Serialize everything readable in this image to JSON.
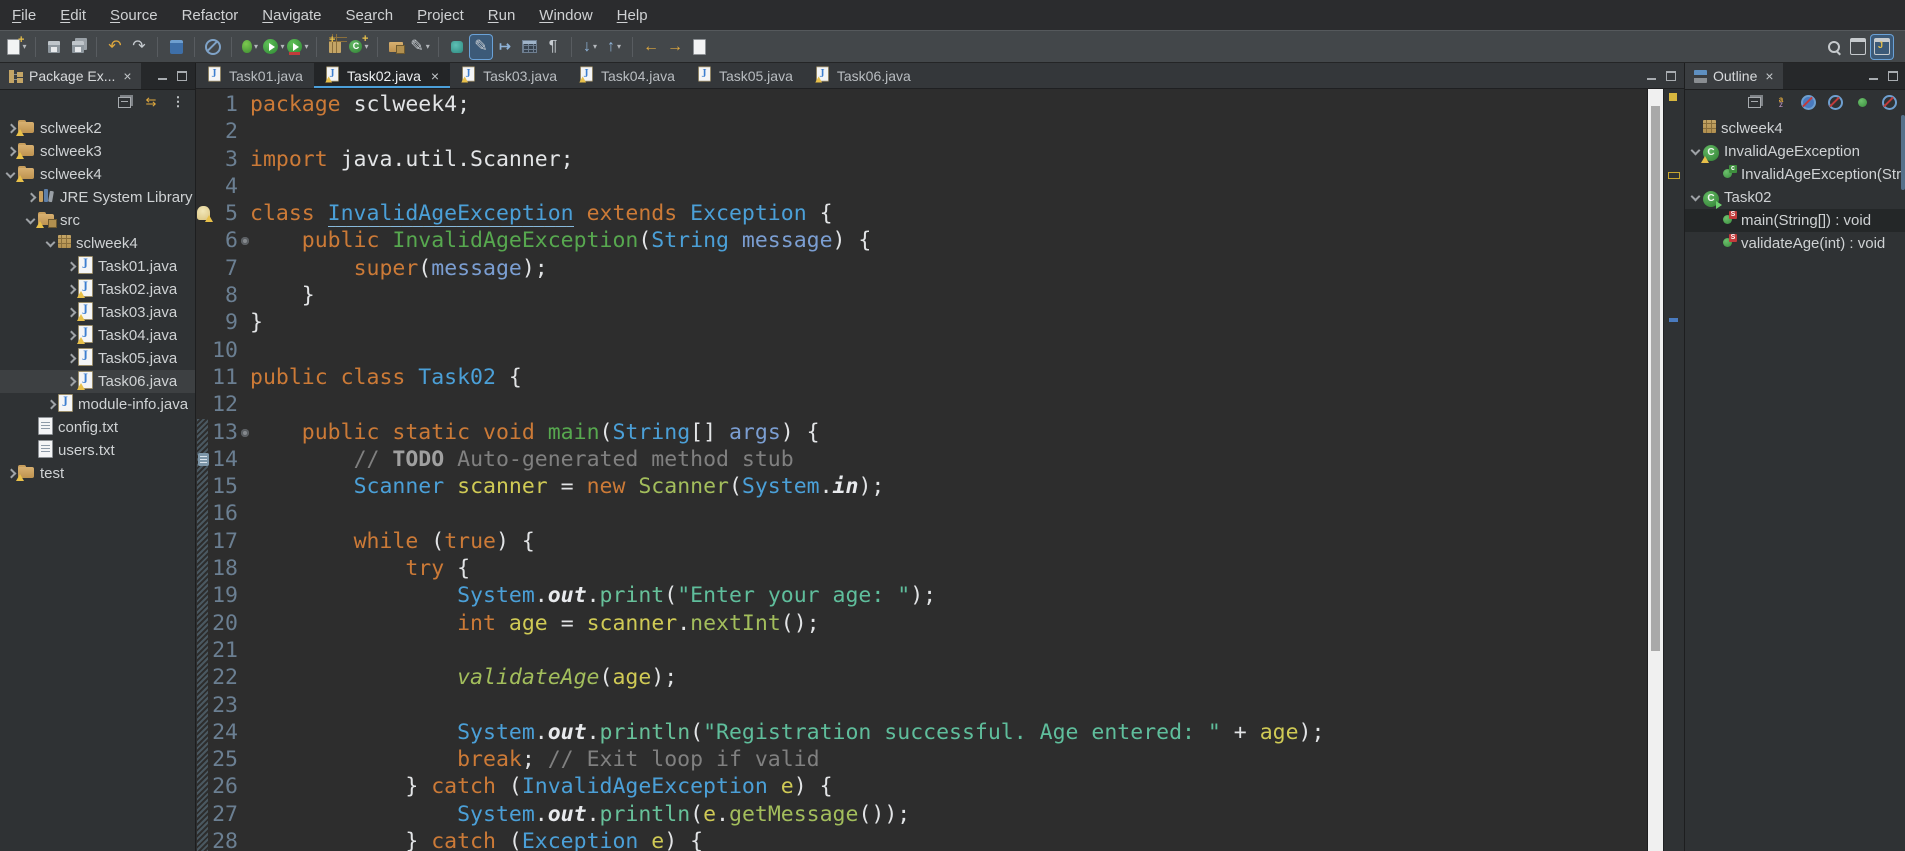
{
  "colors": {
    "accent_blue": "#4B9FD9",
    "warning_yellow": "#D8B73F",
    "editor_bg": "#2D2D2D",
    "toolbar_bg": "#43474A",
    "keyword": "#CC7A37",
    "type": "#4BA0D8",
    "string": "#5FBE9C",
    "variable": "#D0CA55",
    "method_decl": "#57A84F",
    "method_call": "#A3BE5C",
    "comment": "#808080"
  },
  "menu": {
    "items": [
      {
        "label": "File",
        "m": 0
      },
      {
        "label": "Edit",
        "m": 0
      },
      {
        "label": "Source",
        "m": 0
      },
      {
        "label": "Refactor",
        "m": 5
      },
      {
        "label": "Navigate",
        "m": 0
      },
      {
        "label": "Search",
        "m": 2
      },
      {
        "label": "Project",
        "m": 0
      },
      {
        "label": "Run",
        "m": 0
      },
      {
        "label": "Window",
        "m": 0
      },
      {
        "label": "Help",
        "m": 0
      }
    ]
  },
  "toolbar": {
    "items": [
      {
        "name": "new-wizard",
        "kind": "new",
        "dd": true
      },
      {
        "sep": true
      },
      {
        "name": "save",
        "kind": "save"
      },
      {
        "name": "save-all",
        "kind": "saveall"
      },
      {
        "sep": true
      },
      {
        "name": "undo",
        "kind": "undo"
      },
      {
        "name": "redo",
        "kind": "redo"
      },
      {
        "sep": true
      },
      {
        "name": "open-console",
        "kind": "console"
      },
      {
        "sep": true
      },
      {
        "name": "skip-all-breakpoints",
        "kind": "skipbp"
      },
      {
        "sep": true
      },
      {
        "name": "debug",
        "kind": "debug",
        "dd": true
      },
      {
        "name": "run",
        "kind": "run",
        "dd": true
      },
      {
        "name": "coverage",
        "kind": "coverage",
        "dd": true
      },
      {
        "sep": true
      },
      {
        "name": "new-java-project",
        "kind": "newproj"
      },
      {
        "name": "new-class",
        "kind": "newclass",
        "dd": true
      },
      {
        "sep": true
      },
      {
        "name": "new-package",
        "kind": "newpkg"
      },
      {
        "name": "java-editor",
        "kind": "pencil",
        "dd": true
      },
      {
        "sep": true
      },
      {
        "name": "external-tools",
        "kind": "tool"
      },
      {
        "name": "java-editor-active",
        "kind": "editorbtn",
        "hl": true
      },
      {
        "name": "open-type",
        "kind": "typenav"
      },
      {
        "name": "show-view-table",
        "kind": "table"
      },
      {
        "name": "show-whitespace",
        "kind": "pilcrow"
      },
      {
        "sep": true
      },
      {
        "name": "next-annotation",
        "kind": "down",
        "dd": true
      },
      {
        "name": "previous-annotation",
        "kind": "up",
        "dd": true
      },
      {
        "sep": true
      },
      {
        "name": "back",
        "kind": "back"
      },
      {
        "name": "forward",
        "kind": "fwd"
      },
      {
        "name": "last-edit-location",
        "kind": "lastedit"
      }
    ],
    "right_items": [
      {
        "name": "search",
        "kind": "search"
      },
      {
        "name": "open-perspective",
        "kind": "perspective"
      },
      {
        "name": "java-perspective",
        "kind": "javapersp",
        "hl": true
      }
    ]
  },
  "package_explorer": {
    "title": "Package Ex...",
    "tools": [
      {
        "name": "collapse-all",
        "kind": "collapse"
      },
      {
        "name": "link-with-editor",
        "kind": "link"
      },
      {
        "name": "view-menu",
        "kind": "dots"
      }
    ],
    "tree": [
      {
        "label": "sclweek2",
        "level": 0,
        "arrow": "r",
        "icon": "project",
        "warn": true
      },
      {
        "label": "sclweek3",
        "level": 0,
        "arrow": "r",
        "icon": "project",
        "warn": true
      },
      {
        "label": "sclweek4",
        "level": 0,
        "arrow": "d",
        "icon": "project",
        "warn": true
      },
      {
        "label": "JRE System Library",
        "level": 1,
        "arrow": "r",
        "icon": "library"
      },
      {
        "label": "src",
        "level": 1,
        "arrow": "d",
        "icon": "srcfolder",
        "warn": true
      },
      {
        "label": "sclweek4",
        "level": 2,
        "arrow": "d",
        "icon": "package"
      },
      {
        "label": "Task01.java",
        "level": 3,
        "arrow": "r",
        "icon": "jfile"
      },
      {
        "label": "Task02.java",
        "level": 3,
        "arrow": "r",
        "icon": "jfile",
        "warn": true
      },
      {
        "label": "Task03.java",
        "level": 3,
        "arrow": "r",
        "icon": "jfile",
        "warn": true
      },
      {
        "label": "Task04.java",
        "level": 3,
        "arrow": "r",
        "icon": "jfile",
        "warn": true
      },
      {
        "label": "Task05.java",
        "level": 3,
        "arrow": "r",
        "icon": "jfile"
      },
      {
        "label": "Task06.java",
        "level": 3,
        "arrow": "r",
        "icon": "jfile",
        "warn": true,
        "sel": true
      },
      {
        "label": "module-info.java",
        "level": 2,
        "arrow": "r",
        "icon": "jfile"
      },
      {
        "label": "config.txt",
        "level": 1,
        "icon": "txt"
      },
      {
        "label": "users.txt",
        "level": 1,
        "icon": "txt"
      },
      {
        "label": "test",
        "level": 0,
        "arrow": "r",
        "icon": "project",
        "warn": true
      }
    ]
  },
  "editor": {
    "tabs": [
      {
        "label": "Task01.java"
      },
      {
        "label": "Task02.java",
        "warn": true,
        "active": true,
        "close": "×"
      },
      {
        "label": "Task03.java",
        "warn": true
      },
      {
        "label": "Task04.java",
        "warn": true
      },
      {
        "label": "Task05.java"
      },
      {
        "label": "Task06.java",
        "warn": true
      }
    ],
    "code": {
      "lines": [
        {
          "n": "1",
          "t": [
            [
              "k",
              "package "
            ],
            [
              "pl",
              "sclweek4;"
            ]
          ]
        },
        {
          "n": "2",
          "t": []
        },
        {
          "n": "3",
          "t": [
            [
              "k",
              "import "
            ],
            [
              "pl",
              "java.util.Scanner;"
            ]
          ]
        },
        {
          "n": "4",
          "t": []
        },
        {
          "n": "5",
          "gutter": "warning",
          "t": [
            [
              "k",
              "class "
            ],
            [
              "tw",
              "InvalidAgeException"
            ],
            [
              "pl",
              " "
            ],
            [
              "k",
              "extends "
            ],
            [
              "t",
              "Exception"
            ],
            [
              "pl",
              " {"
            ]
          ]
        },
        {
          "n": "6",
          "fold": true,
          "t": [
            [
              "pl",
              "    "
            ],
            [
              "k",
              "public "
            ],
            [
              "m",
              "InvalidAgeException"
            ],
            [
              "pl",
              "("
            ],
            [
              "t",
              "String"
            ],
            [
              "pl",
              " "
            ],
            [
              "p",
              "message"
            ],
            [
              "pl",
              ") {"
            ]
          ]
        },
        {
          "n": "7",
          "t": [
            [
              "pl",
              "        "
            ],
            [
              "k",
              "super"
            ],
            [
              "pl",
              "("
            ],
            [
              "p",
              "message"
            ],
            [
              "pl",
              ");"
            ]
          ]
        },
        {
          "n": "8",
          "t": [
            [
              "pl",
              "    }"
            ]
          ]
        },
        {
          "n": "9",
          "t": [
            [
              "pl",
              "}"
            ]
          ]
        },
        {
          "n": "10",
          "t": []
        },
        {
          "n": "11",
          "t": [
            [
              "k",
              "public class "
            ],
            [
              "t",
              "Task02"
            ],
            [
              "pl",
              " {"
            ]
          ]
        },
        {
          "n": "12",
          "t": []
        },
        {
          "n": "13",
          "fold": true,
          "t": [
            [
              "pl",
              "    "
            ],
            [
              "k",
              "public static void "
            ],
            [
              "m",
              "main"
            ],
            [
              "pl",
              "("
            ],
            [
              "t",
              "String"
            ],
            [
              "pl",
              "[] "
            ],
            [
              "p",
              "args"
            ],
            [
              "pl",
              ") {"
            ]
          ]
        },
        {
          "n": "14",
          "gutter": "task",
          "t": [
            [
              "pl",
              "        "
            ],
            [
              "cm",
              "// "
            ],
            [
              "td",
              "TODO"
            ],
            [
              "cm",
              " Auto-generated method stub"
            ]
          ]
        },
        {
          "n": "15",
          "t": [
            [
              "pl",
              "        "
            ],
            [
              "t",
              "Scanner"
            ],
            [
              "pl",
              " "
            ],
            [
              "v",
              "scanner"
            ],
            [
              "pl",
              " = "
            ],
            [
              "k",
              "new "
            ],
            [
              "c",
              "Scanner"
            ],
            [
              "pl",
              "("
            ],
            [
              "t",
              "System"
            ],
            [
              "pl",
              "."
            ],
            [
              "f",
              "in"
            ],
            [
              "pl",
              ");"
            ]
          ]
        },
        {
          "n": "16",
          "t": []
        },
        {
          "n": "17",
          "t": [
            [
              "pl",
              "        "
            ],
            [
              "k",
              "while"
            ],
            [
              "pl",
              " ("
            ],
            [
              "k",
              "true"
            ],
            [
              "pl",
              ") {"
            ]
          ]
        },
        {
          "n": "18",
          "t": [
            [
              "pl",
              "            "
            ],
            [
              "k",
              "try"
            ],
            [
              "pl",
              " {"
            ]
          ]
        },
        {
          "n": "19",
          "t": [
            [
              "pl",
              "                "
            ],
            [
              "t",
              "System"
            ],
            [
              "pl",
              "."
            ],
            [
              "f",
              "out"
            ],
            [
              "pl",
              "."
            ],
            [
              "lb",
              "print"
            ],
            [
              "pl",
              "("
            ],
            [
              "s",
              "\"Enter your age: \""
            ],
            [
              "pl",
              ");"
            ]
          ]
        },
        {
          "n": "20",
          "t": [
            [
              "pl",
              "                "
            ],
            [
              "k",
              "int"
            ],
            [
              "pl",
              " "
            ],
            [
              "v",
              "age"
            ],
            [
              "pl",
              " = "
            ],
            [
              "v",
              "scanner"
            ],
            [
              "pl",
              "."
            ],
            [
              "c",
              "nextInt"
            ],
            [
              "pl",
              "();"
            ]
          ]
        },
        {
          "n": "21",
          "t": []
        },
        {
          "n": "22",
          "t": [
            [
              "pl",
              "                "
            ],
            [
              "ci",
              "validateAge"
            ],
            [
              "pl",
              "("
            ],
            [
              "v",
              "age"
            ],
            [
              "pl",
              ");"
            ]
          ]
        },
        {
          "n": "23",
          "t": []
        },
        {
          "n": "24",
          "t": [
            [
              "pl",
              "                "
            ],
            [
              "t",
              "System"
            ],
            [
              "pl",
              "."
            ],
            [
              "f",
              "out"
            ],
            [
              "pl",
              "."
            ],
            [
              "lb",
              "println"
            ],
            [
              "pl",
              "("
            ],
            [
              "s",
              "\"Registration successful. Age entered: \""
            ],
            [
              "pl",
              " + "
            ],
            [
              "v",
              "age"
            ],
            [
              "pl",
              ");"
            ]
          ]
        },
        {
          "n": "25",
          "t": [
            [
              "pl",
              "                "
            ],
            [
              "k",
              "break"
            ],
            [
              "pl",
              "; "
            ],
            [
              "cm",
              "// Exit loop if valid"
            ]
          ]
        },
        {
          "n": "26",
          "t": [
            [
              "pl",
              "            } "
            ],
            [
              "k",
              "catch"
            ],
            [
              "pl",
              " ("
            ],
            [
              "t",
              "InvalidAgeException"
            ],
            [
              "pl",
              " "
            ],
            [
              "v",
              "e"
            ],
            [
              "pl",
              ") {"
            ]
          ]
        },
        {
          "n": "27",
          "t": [
            [
              "pl",
              "                "
            ],
            [
              "t",
              "System"
            ],
            [
              "pl",
              "."
            ],
            [
              "f",
              "out"
            ],
            [
              "pl",
              "."
            ],
            [
              "lb",
              "println"
            ],
            [
              "pl",
              "("
            ],
            [
              "v",
              "e"
            ],
            [
              "pl",
              "."
            ],
            [
              "c",
              "getMessage"
            ],
            [
              "pl",
              "());"
            ]
          ]
        },
        {
          "n": "28",
          "t": [
            [
              "pl",
              "            } "
            ],
            [
              "k",
              "catch"
            ],
            [
              "pl",
              " ("
            ],
            [
              "t",
              "Exception"
            ],
            [
              "pl",
              " "
            ],
            [
              "v",
              "e"
            ],
            [
              "pl",
              ") {"
            ]
          ]
        }
      ]
    }
  },
  "outline": {
    "title": "Outline",
    "tools": [
      {
        "name": "collapse-all",
        "kind": "collapse"
      },
      {
        "name": "sort",
        "kind": "az"
      },
      {
        "name": "hide-fields",
        "kind": "hidefields"
      },
      {
        "name": "hide-static-members",
        "kind": "hideslash"
      },
      {
        "name": "hide-non-public",
        "kind": "greendot"
      },
      {
        "name": "hide-local-types",
        "kind": "hideslash"
      }
    ],
    "items": [
      {
        "label": "sclweek4",
        "level": 0,
        "icon": "package"
      },
      {
        "label": "InvalidAgeException",
        "level": 0,
        "arrow": "d",
        "icon": "class",
        "warn": true
      },
      {
        "label": "InvalidAgeException(String)",
        "level": 1,
        "icon": "ctor"
      },
      {
        "label": "Task02",
        "level": 0,
        "arrow": "d",
        "icon": "classrun"
      },
      {
        "label": "main(String[]) : void",
        "level": 1,
        "icon": "methods",
        "sel": true
      },
      {
        "label": "validateAge(int) : void",
        "level": 1,
        "icon": "methods"
      }
    ]
  }
}
